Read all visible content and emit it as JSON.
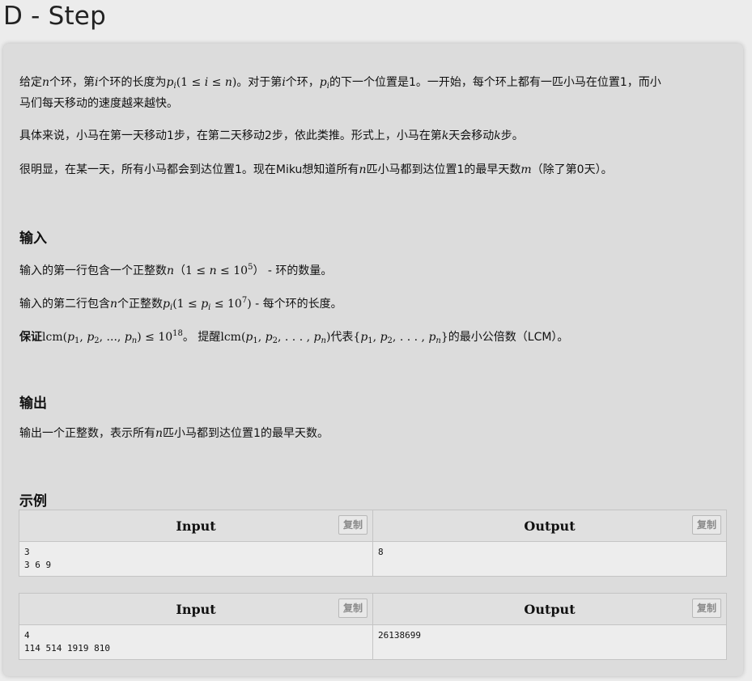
{
  "title": "D - Step",
  "description": {
    "p1_line1": [
      "给定",
      "n",
      "个环，第",
      "i",
      "个环的长度为",
      "p",
      "i",
      "(1 ≤ ",
      "i",
      " ≤ ",
      "n",
      ")",
      "。对于第",
      "i",
      "个环，",
      "p",
      "i",
      "的下一个位置是1。一开始，每个环上都有一匹小马在位置1，而小"
    ],
    "p1_line2": "马们每天移动的速度越来越快。",
    "p2": [
      "具体来说，小马在第一天移动1步，在第二天移动2步，依此类推。形式上，小马在第",
      "k",
      "天会移动",
      "k",
      "步。"
    ],
    "p3": [
      "很明显，在某一天，所有小马都会到达位置1。现在Miku想知道所有",
      "n",
      "匹小马都到达位置1的最早天数",
      "m",
      "（除了第0天）。"
    ]
  },
  "input_section": {
    "heading": "输入",
    "line1": [
      "输入的第一行包含一个正整数",
      "n",
      "（",
      "1 ≤ ",
      "n",
      " ≤ 10",
      "5",
      "）",
      " - 环的数量。"
    ],
    "line2": [
      "输入的第二行包含",
      "n",
      "个正整数",
      "p",
      "i",
      "(1 ≤ ",
      "p",
      "i",
      " ≤ 10",
      "7",
      ")",
      " - 每个环的长度。"
    ],
    "line3": [
      "保证",
      "lcm(",
      "p",
      "1",
      ", ",
      "p",
      "2",
      ", ..., ",
      "p",
      "n",
      ") ≤ 10",
      "18",
      "。 提醒",
      "lcm(",
      "p",
      "1",
      ", ",
      "p",
      "2",
      ", . . . , ",
      "p",
      "n",
      ")",
      "代表",
      "{",
      "p",
      "1",
      ", ",
      "p",
      "2",
      ", . . . , ",
      "p",
      "n",
      "}",
      "的最小公倍数（LCM）。"
    ]
  },
  "output_section": {
    "heading": "输出",
    "line1": [
      "输出一个正整数，表示所有",
      "n",
      "匹小马都到达位置1的最早天数。"
    ]
  },
  "examples": {
    "heading": "示例",
    "input_header": "Input",
    "output_header": "Output",
    "copy_label": "复制",
    "cases": [
      {
        "input": "3\n3 6 9",
        "output": "8"
      },
      {
        "input": "4\n114 514 1919 810",
        "output": "26138699"
      }
    ]
  }
}
